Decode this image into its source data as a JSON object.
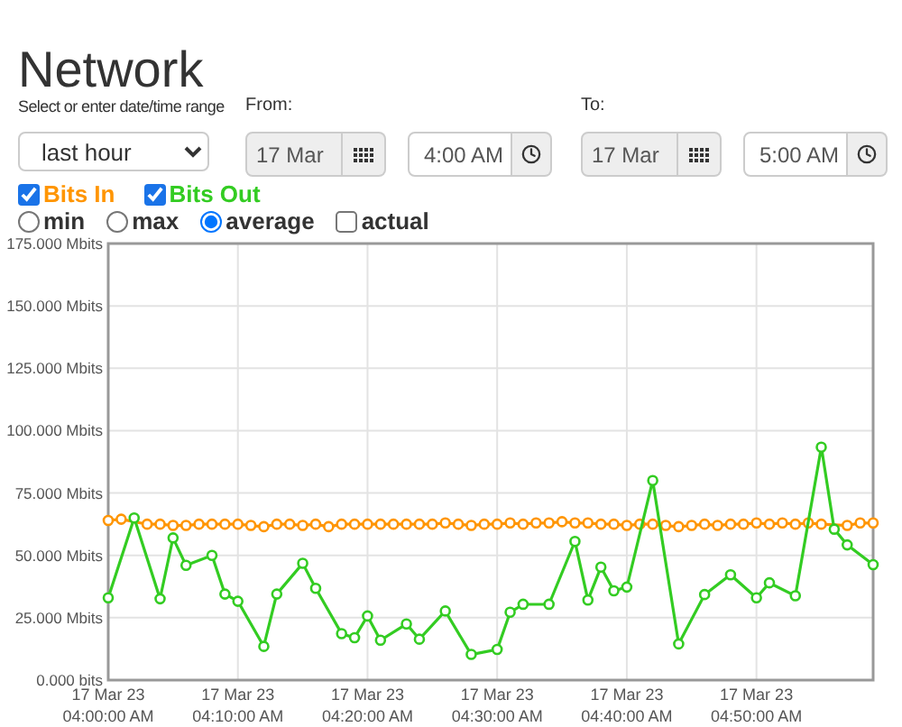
{
  "title": "Network",
  "range": {
    "label": "Select or enter date/time range",
    "value": "last hour"
  },
  "from": {
    "label": "From:",
    "date": "17 Mar",
    "time": "4:00 AM"
  },
  "to": {
    "label": "To:",
    "date": "17 Mar",
    "time": "5:00 AM"
  },
  "series_toggles": [
    {
      "checked": true
    },
    {
      "checked": true
    }
  ],
  "modes": [
    {
      "kind": "radio",
      "label": "min",
      "selected": false
    },
    {
      "kind": "radio",
      "label": "max",
      "selected": false
    },
    {
      "kind": "radio",
      "label": "average",
      "selected": true
    },
    {
      "kind": "checkbox",
      "label": "actual",
      "checked": false
    }
  ],
  "chart_data": {
    "type": "line",
    "categories": [
      "17 Mar 23\n04:00:00 AM",
      null,
      null,
      null,
      null,
      null,
      null,
      null,
      null,
      null,
      "17 Mar 23\n04:10:00 AM",
      null,
      null,
      null,
      null,
      null,
      null,
      null,
      null,
      null,
      "17 Mar 23\n04:20:00 AM",
      null,
      null,
      null,
      null,
      null,
      null,
      null,
      null,
      null,
      "17 Mar 23\n04:30:00 AM",
      null,
      null,
      null,
      null,
      null,
      null,
      null,
      null,
      null,
      "17 Mar 23\n04:40:00 AM",
      null,
      null,
      null,
      null,
      null,
      null,
      null,
      null,
      null,
      "17 Mar 23\n04:50:00 AM",
      null,
      null,
      null,
      null,
      null,
      null,
      null,
      null,
      null
    ],
    "grid": true,
    "ylim": [
      0,
      175
    ],
    "yticks": [
      {
        "value": 0,
        "label": "0.000 bits"
      },
      {
        "value": 25,
        "label": "25.000 Mbits"
      },
      {
        "value": 50,
        "label": "50.000 Mbits"
      },
      {
        "value": 75,
        "label": "75.000 Mbits"
      },
      {
        "value": 100,
        "label": "100.000 Mbits"
      },
      {
        "value": 125,
        "label": "125.000 Mbits"
      },
      {
        "value": 150,
        "label": "150.000 Mbits"
      },
      {
        "value": 175,
        "label": "175.000 Mbits"
      }
    ],
    "series": [
      {
        "name": "Bits In",
        "color": "#ff9500",
        "marker": "circle",
        "values": [
          64,
          64.5,
          null,
          62.5,
          62.5,
          62,
          62,
          62.5,
          62.5,
          62.5,
          62.5,
          62,
          61.5,
          62.5,
          62.5,
          62,
          62.5,
          61.5,
          62.5,
          62.5,
          62.5,
          62.5,
          62.5,
          62.5,
          62.5,
          62.5,
          63,
          62.5,
          62,
          62.5,
          62.5,
          63,
          62.5,
          63,
          63,
          63.5,
          63,
          63,
          62.5,
          62.5,
          62,
          62.5,
          62.5,
          62,
          61.5,
          62,
          62.5,
          62,
          62.5,
          62.5,
          63,
          62.5,
          63,
          62.5,
          63,
          62.5,
          null,
          62,
          63,
          63
        ]
      },
      {
        "name": "Bits Out",
        "color": "#33cc22",
        "marker": "circle",
        "values": [
          33,
          null,
          65,
          null,
          32.6,
          57,
          46,
          null,
          50,
          34.5,
          31.6,
          null,
          13.5,
          34.5,
          null,
          46.8,
          36.8,
          null,
          18.6,
          17,
          25.7,
          16,
          null,
          22.5,
          16.4,
          null,
          27.7,
          null,
          10.3,
          null,
          12.3,
          27.2,
          30.4,
          null,
          30.4,
          null,
          55.6,
          32.1,
          45.3,
          35.8,
          37.3,
          null,
          80,
          null,
          14.5,
          null,
          34.3,
          null,
          42.2,
          null,
          33,
          39,
          null,
          33.8,
          null,
          93.4,
          60.5,
          54.2,
          null,
          46.3
        ]
      }
    ]
  }
}
